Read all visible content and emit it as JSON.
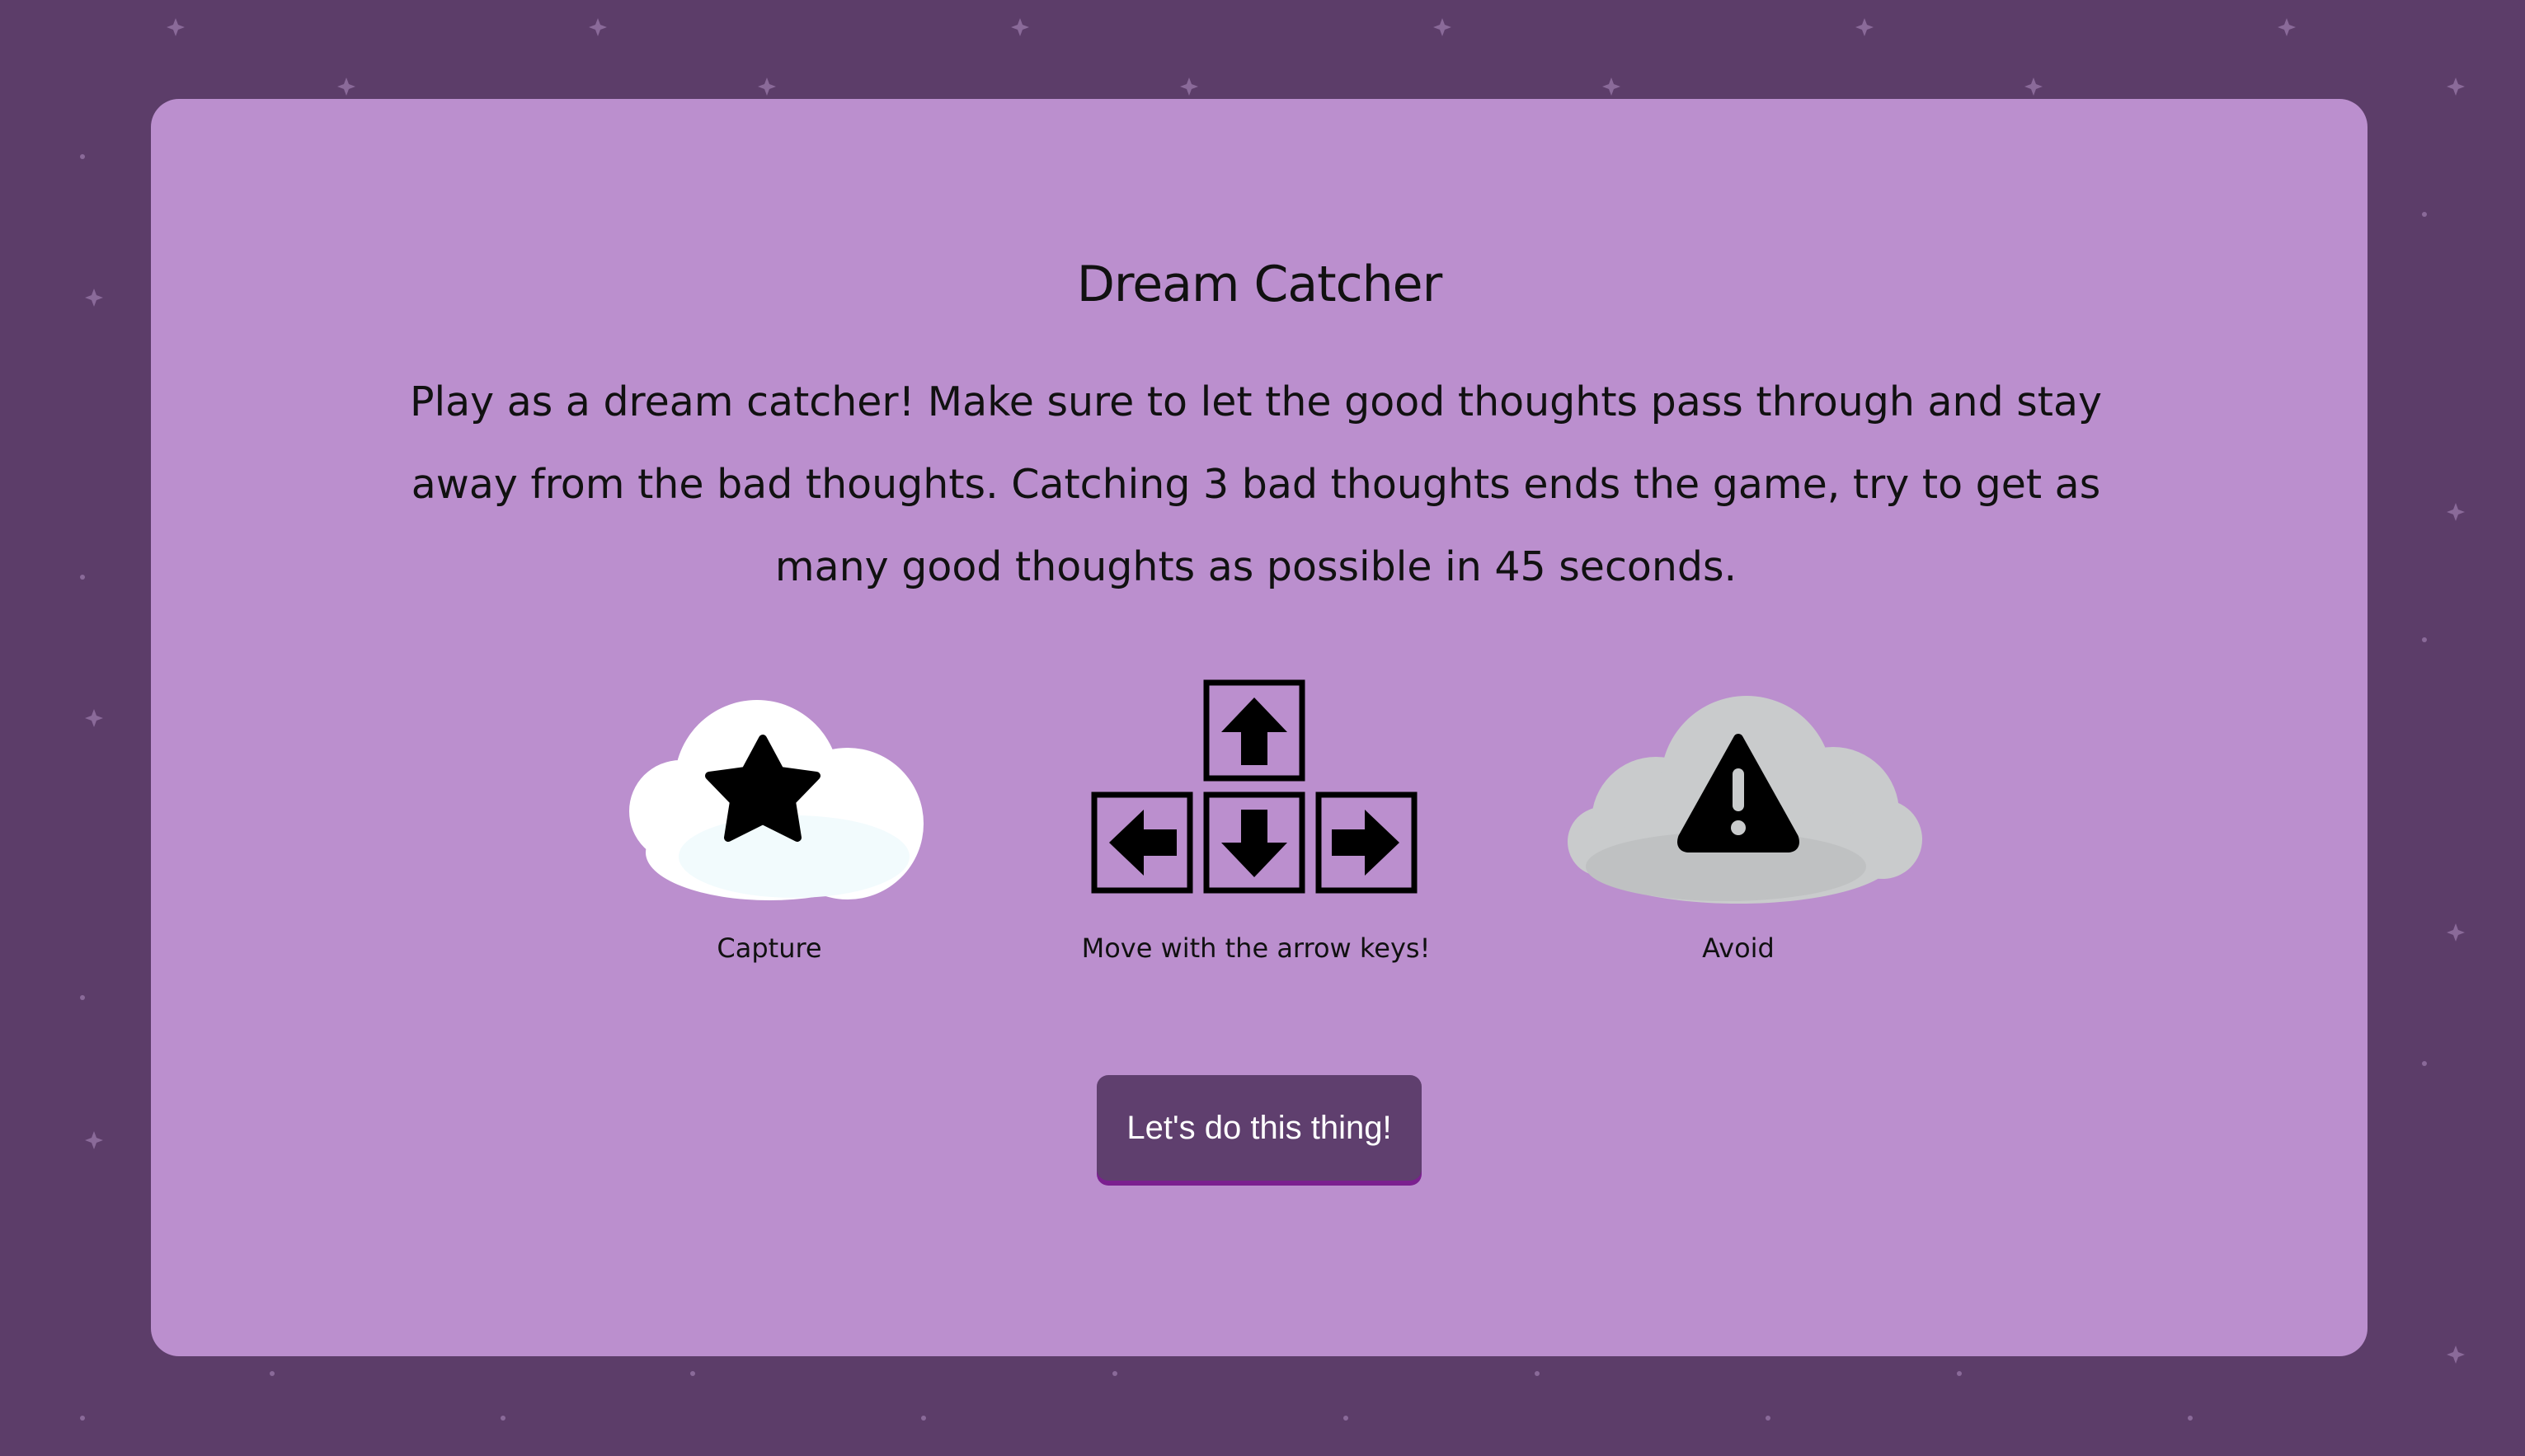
{
  "game": {
    "title": "Dream Catcher",
    "description": "Play as a dream catcher! Make sure to let the good thoughts pass through and stay away from the bad thoughts. Catching 3 bad thoughts ends the game, try to get as many good thoughts as possible in 45 seconds."
  },
  "instructions": {
    "capture": {
      "label": "Capture",
      "icon": "star-cloud-icon"
    },
    "move": {
      "label": "Move with the arrow keys!",
      "icon": "arrow-keys-icon"
    },
    "avoid": {
      "label": "Avoid",
      "icon": "warning-cloud-icon"
    }
  },
  "start_button": {
    "label": "Let's do this thing!"
  },
  "colors": {
    "background": "#5c3d69",
    "card": "#bb8fce",
    "button": "#5f3f6e",
    "button_underline": "#7b1f8f",
    "good_cloud": "#ffffff",
    "bad_cloud": "#c9cbcc"
  }
}
